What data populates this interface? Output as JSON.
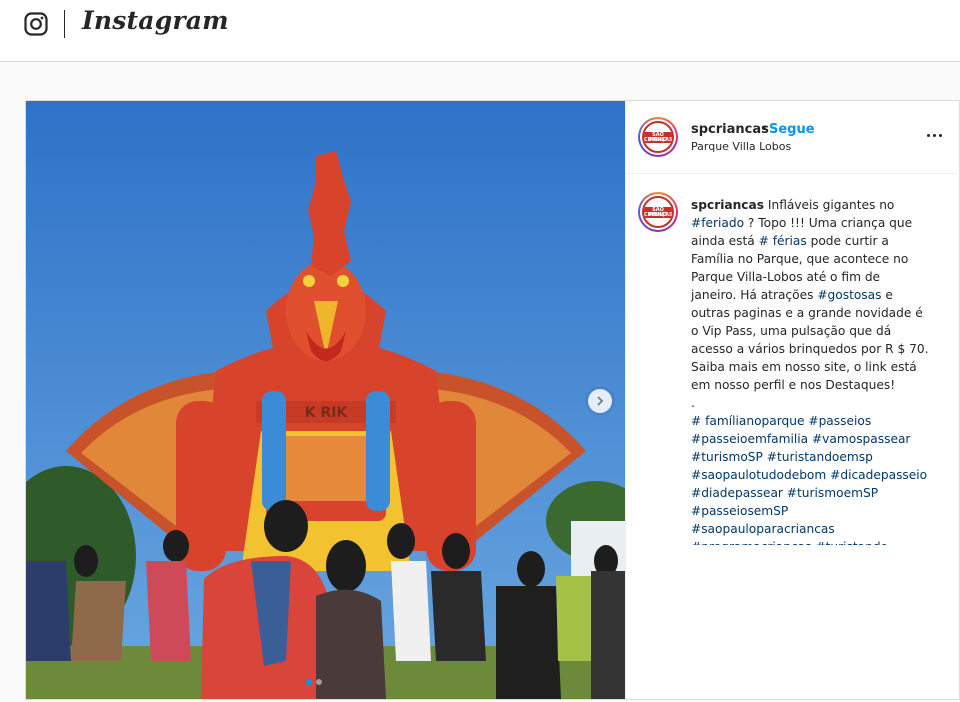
{
  "app": {
    "name": "Instagram"
  },
  "icons": {
    "logo": "instagram-camera-icon",
    "next": "chevron-right-icon",
    "more": "more-options-icon"
  },
  "colors": {
    "link": "#0095f6",
    "hashtag": "#00376b",
    "text": "#262626",
    "border": "#dbdbdb"
  },
  "post": {
    "username": "spcriancas",
    "separator": "•",
    "follow_label": "Segue",
    "location": "Parque Villa Lobos",
    "avatar_text_top": "SÃO PAULO",
    "avatar_text_bottom": "CRIANÇAS",
    "image_description": "inflatable rooster bounce house in a park with children and adults",
    "inflatable_text": "K RIK",
    "carousel": {
      "current": 1,
      "total": 2
    },
    "caption_lines": [
      [
        {
          "t": "spcriancas",
          "k": "user"
        },
        {
          "t": " Infláveis gigantes no",
          "k": "text"
        }
      ],
      [
        {
          "t": "#feriado",
          "k": "tag"
        },
        {
          "t": " ? Topo !!! Uma criança que",
          "k": "text"
        }
      ],
      [
        {
          "t": "ainda está ",
          "k": "text"
        },
        {
          "t": "# férias",
          "k": "tag"
        },
        {
          "t": " pode curtir a",
          "k": "text"
        }
      ],
      [
        {
          "t": "Família no Parque, que acontece no",
          "k": "text"
        }
      ],
      [
        {
          "t": "Parque Villa-Lobos até o fim de",
          "k": "text"
        }
      ],
      [
        {
          "t": "janeiro. Há atrações ",
          "k": "text"
        },
        {
          "t": "#gostosas",
          "k": "tag"
        },
        {
          "t": " e",
          "k": "text"
        }
      ],
      [
        {
          "t": "outras paginas e a grande novidade é",
          "k": "text"
        }
      ],
      [
        {
          "t": "o Vip Pass, uma pulsação que dá",
          "k": "text"
        }
      ],
      [
        {
          "t": "acesso a vários brinquedos por R $ 70.",
          "k": "text"
        }
      ],
      [
        {
          "t": "Saiba mais em nosso site, o link está",
          "k": "text"
        }
      ],
      [
        {
          "t": "em nosso perfil e nos Destaques!",
          "k": "text"
        }
      ],
      [
        {
          "t": ".",
          "k": "text"
        }
      ],
      [
        {
          "t": "# famílianoparque",
          "k": "tag"
        },
        {
          "t": " ",
          "k": "text"
        },
        {
          "t": "#passeios",
          "k": "tag"
        }
      ],
      [
        {
          "t": "#passeioemfamilia",
          "k": "tag"
        },
        {
          "t": " ",
          "k": "text"
        },
        {
          "t": "#vamospassear",
          "k": "tag"
        }
      ],
      [
        {
          "t": "#turismoSP",
          "k": "tag"
        },
        {
          "t": " ",
          "k": "text"
        },
        {
          "t": "#turistandoemsp",
          "k": "tag"
        }
      ],
      [
        {
          "t": "#saopaulotudodebom",
          "k": "tag"
        },
        {
          "t": " ",
          "k": "text"
        },
        {
          "t": "#dicadepasseio",
          "k": "tag"
        }
      ],
      [
        {
          "t": "#diadepassear",
          "k": "tag"
        },
        {
          "t": " ",
          "k": "text"
        },
        {
          "t": "#turismoemSP",
          "k": "tag"
        }
      ],
      [
        {
          "t": "#passeiosemSP",
          "k": "tag"
        }
      ],
      [
        {
          "t": "#saopauloparacriancas",
          "k": "tag"
        }
      ],
      [
        {
          "t": "#programacriancas",
          "k": "tag"
        },
        {
          "t": " ",
          "k": "text"
        },
        {
          "t": "#turistando",
          "k": "tag"
        }
      ]
    ]
  }
}
